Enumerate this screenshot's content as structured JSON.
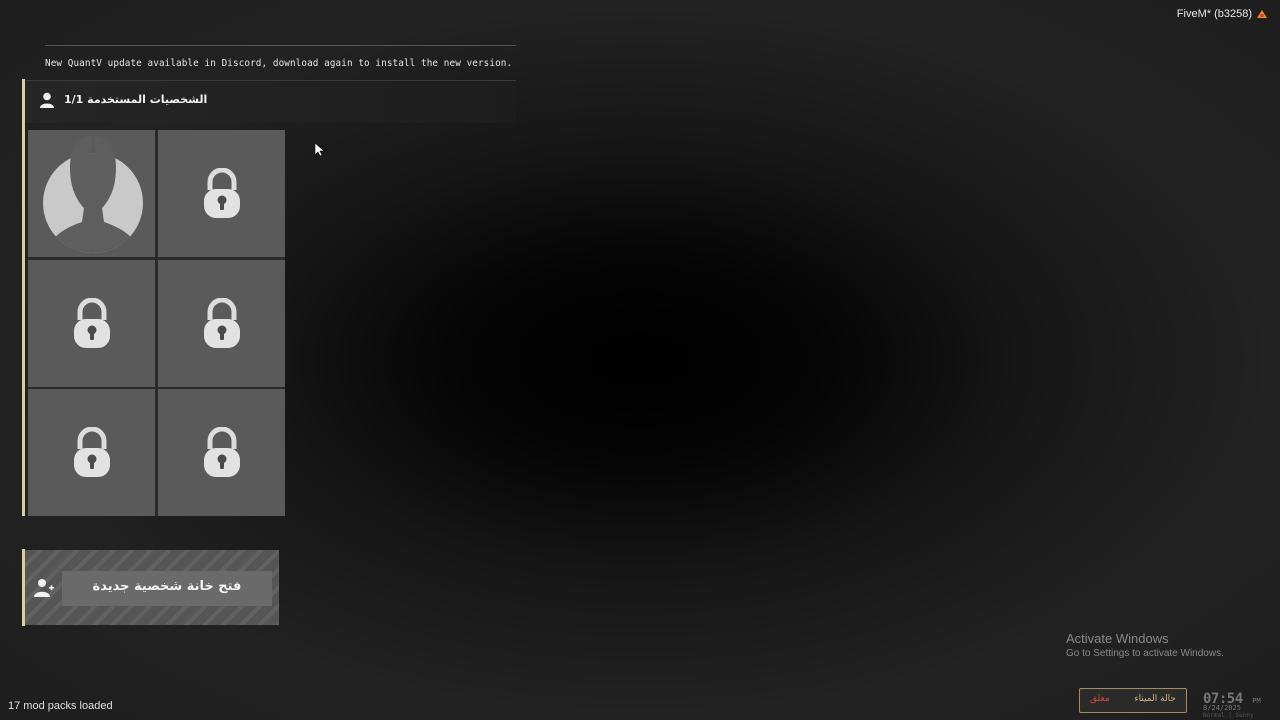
{
  "app": {
    "title": "FiveM* (b3258)"
  },
  "notice": {
    "text": "New QuantV update available in Discord, download again to install the new version."
  },
  "characters": {
    "header_title": "الشخصيات المستخدمة 1/1",
    "slots": [
      {
        "state": "occupied",
        "icon": "avatar-silhouette"
      },
      {
        "state": "locked",
        "icon": "lock-icon"
      },
      {
        "state": "locked",
        "icon": "lock-icon"
      },
      {
        "state": "locked",
        "icon": "lock-icon"
      },
      {
        "state": "locked",
        "icon": "lock-icon"
      },
      {
        "state": "locked",
        "icon": "lock-icon"
      }
    ],
    "new_slot_label": "فتح خانة شخصية جديدة"
  },
  "status": {
    "mod_packs": "17 mod packs loaded"
  },
  "windows": {
    "activate_title": "Activate Windows",
    "activate_hint": "Go to Settings to activate Windows."
  },
  "hud": {
    "port_label": "حالة الميناء",
    "port_value": "مغلق",
    "time": "07:54",
    "ampm": "PM",
    "date": "8/24/2025",
    "weather": "Normal | Sunny"
  },
  "colors": {
    "accent": "#d9cf9c",
    "port_closed": "#d34a3a",
    "port_border": "#a68c58"
  }
}
